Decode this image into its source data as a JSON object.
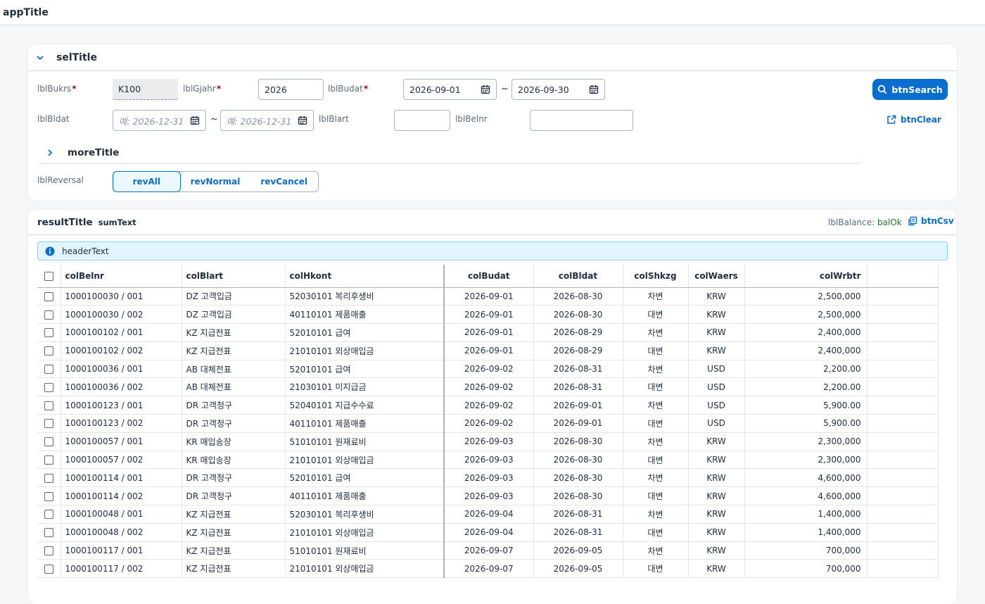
{
  "app": {
    "title": "appTitle"
  },
  "selection": {
    "title": "selTitle",
    "labels": {
      "bukrs": "lblBukrs",
      "gjahr": "lblGjahr",
      "budat": "lblBudat",
      "bldat": "lblBldat",
      "blart": "lblBlart",
      "belnr": "lblBelnr",
      "reversal": "lblReversal"
    },
    "values": {
      "bukrs": "K100",
      "gjahr": "2026",
      "budat_from": "2026-09-01",
      "budat_to": "2026-09-30",
      "bldat_from": "",
      "bldat_to": "",
      "blart": "",
      "belnr": ""
    },
    "placeholders": {
      "bldat_from": "예: 2026-12-31",
      "bldat_to": "예: 2026-12-31"
    },
    "required_mark": "*",
    "range_sep": "~",
    "buttons": {
      "search": "btnSearch",
      "clear": "btnClear"
    },
    "more_title": "moreTitle",
    "reversal_options": [
      {
        "label": "revAll",
        "selected": true
      },
      {
        "label": "revNormal",
        "selected": false
      },
      {
        "label": "revCancel",
        "selected": false
      }
    ]
  },
  "results": {
    "title": "resultTitle",
    "sum_text": "sumText",
    "balance_label": "lblBalance:",
    "balance_value": "balOk",
    "csv_button": "btnCsv",
    "header_text": "headerText",
    "columns": [
      "colBelnr",
      "colBlart",
      "colHkont",
      "colBudat",
      "colBldat",
      "colShkzg",
      "colWaers",
      "colWrbtr"
    ],
    "rows": [
      [
        "1000100030 / 001",
        "DZ 고객입금",
        "52030101 복리후생비",
        "2026-09-01",
        "2026-08-30",
        "차변",
        "KRW",
        "2,500,000"
      ],
      [
        "1000100030 / 002",
        "DZ 고객입금",
        "40110101 제품매출",
        "2026-09-01",
        "2026-08-30",
        "대변",
        "KRW",
        "2,500,000"
      ],
      [
        "1000100102 / 001",
        "KZ 지급전표",
        "52010101 급여",
        "2026-09-01",
        "2026-08-29",
        "차변",
        "KRW",
        "2,400,000"
      ],
      [
        "1000100102 / 002",
        "KZ 지급전표",
        "21010101 외상매입금",
        "2026-09-01",
        "2026-08-29",
        "대변",
        "KRW",
        "2,400,000"
      ],
      [
        "1000100036 / 001",
        "AB 대체전표",
        "52010101 급여",
        "2026-09-02",
        "2026-08-31",
        "차변",
        "USD",
        "2,200.00"
      ],
      [
        "1000100036 / 002",
        "AB 대체전표",
        "21030101 미지급금",
        "2026-09-02",
        "2026-08-31",
        "대변",
        "USD",
        "2,200.00"
      ],
      [
        "1000100123 / 001",
        "DR 고객청구",
        "52040101 지급수수료",
        "2026-09-02",
        "2026-09-01",
        "차변",
        "USD",
        "5,900.00"
      ],
      [
        "1000100123 / 002",
        "DR 고객청구",
        "40110101 제품매출",
        "2026-09-02",
        "2026-09-01",
        "대변",
        "USD",
        "5,900.00"
      ],
      [
        "1000100057 / 001",
        "KR 매입송장",
        "51010101 원재료비",
        "2026-09-03",
        "2026-08-30",
        "차변",
        "KRW",
        "2,300,000"
      ],
      [
        "1000100057 / 002",
        "KR 매입송장",
        "21010101 외상매입금",
        "2026-09-03",
        "2026-08-30",
        "대변",
        "KRW",
        "2,300,000"
      ],
      [
        "1000100114 / 001",
        "DR 고객청구",
        "52010101 급여",
        "2026-09-03",
        "2026-08-30",
        "차변",
        "KRW",
        "4,600,000"
      ],
      [
        "1000100114 / 002",
        "DR 고객청구",
        "40110101 제품매출",
        "2026-09-03",
        "2026-08-30",
        "대변",
        "KRW",
        "4,600,000"
      ],
      [
        "1000100048 / 001",
        "KZ 지급전표",
        "52030101 복리후생비",
        "2026-09-04",
        "2026-08-31",
        "차변",
        "KRW",
        "1,400,000"
      ],
      [
        "1000100048 / 002",
        "KZ 지급전표",
        "21010101 외상매입금",
        "2026-09-04",
        "2026-08-31",
        "대변",
        "KRW",
        "1,400,000"
      ],
      [
        "1000100117 / 001",
        "KZ 지급전표",
        "51010101 원재료비",
        "2026-09-07",
        "2026-09-05",
        "차변",
        "KRW",
        "700,000"
      ],
      [
        "1000100117 / 002",
        "KZ 지급전표",
        "21010101 외상매입금",
        "2026-09-07",
        "2026-09-05",
        "대변",
        "KRW",
        "700,000"
      ]
    ]
  }
}
